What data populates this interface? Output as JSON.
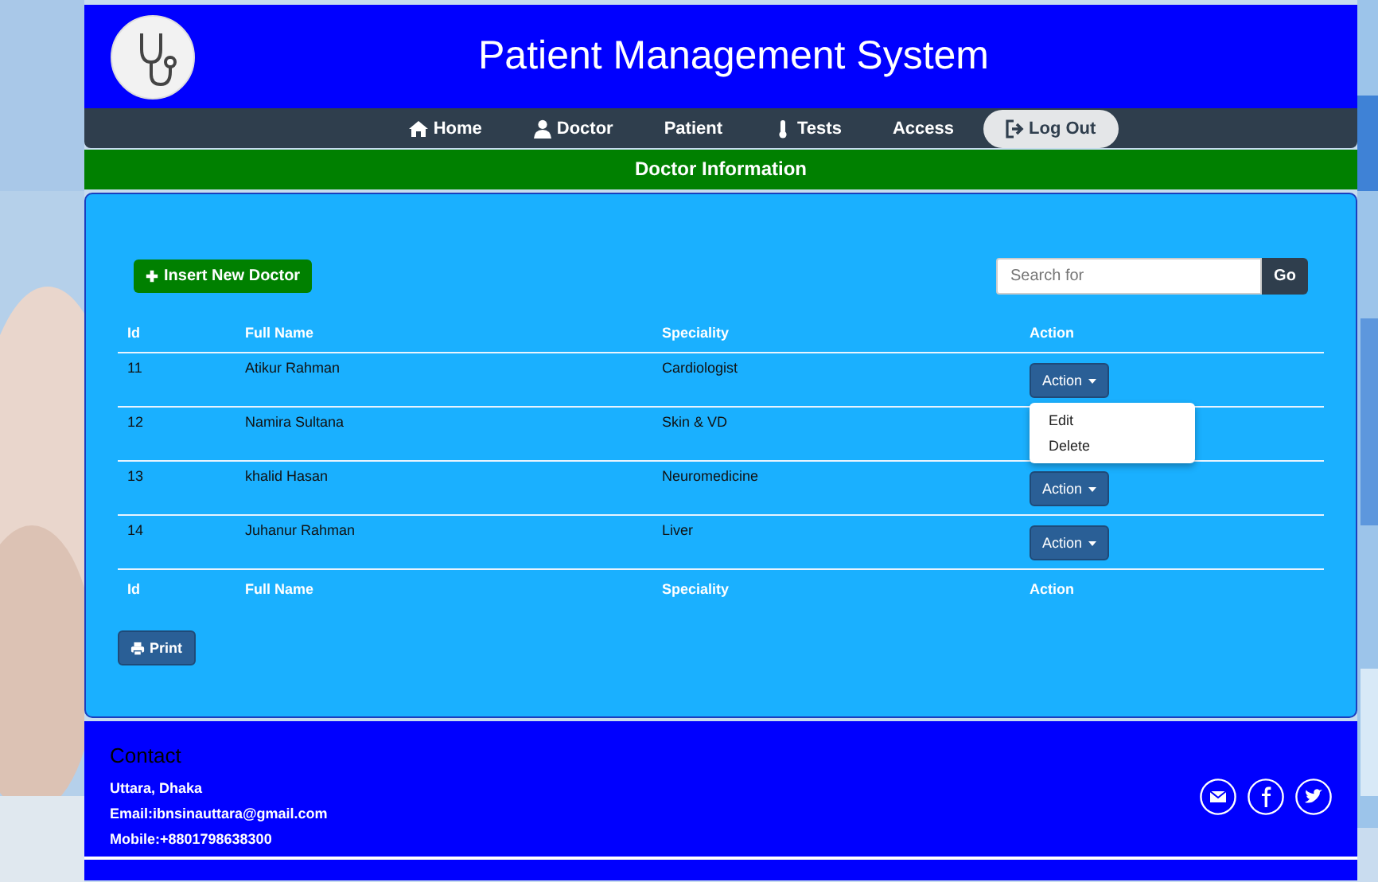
{
  "header": {
    "title": "Patient Management System"
  },
  "nav": [
    {
      "label": "Home",
      "selected": false
    },
    {
      "label": "Doctor",
      "selected": false
    },
    {
      "label": "Patient",
      "selected": false
    },
    {
      "label": "Tests",
      "selected": false
    },
    {
      "label": "Access",
      "selected": false
    },
    {
      "label": "Log Out",
      "selected": true
    }
  ],
  "section_title": "Doctor Information",
  "insert_button": "Insert New Doctor",
  "search": {
    "placeholder": "Search for",
    "button": "Go"
  },
  "table": {
    "columns": [
      "Id",
      "Full Name",
      "Speciality",
      "Action"
    ],
    "rows": [
      {
        "id": "11",
        "name": "Atikur Rahman",
        "speciality": "Cardiologist",
        "action": "Action",
        "menu": [
          "Edit",
          "Delete"
        ]
      },
      {
        "id": "12",
        "name": "Namira Sultana",
        "speciality": "Skin & VD"
      },
      {
        "id": "13",
        "name": "khalid Hasan",
        "speciality": "Neuromedicine",
        "action": "Action"
      },
      {
        "id": "14",
        "name": "Juhanur Rahman",
        "speciality": "Liver",
        "action": "Action"
      }
    ],
    "footer_columns": [
      "Id",
      "Full Name",
      "Speciality",
      "Action"
    ]
  },
  "print_button": "Print",
  "footer": {
    "heading": "Contact",
    "lines": [
      "Uttara, Dhaka",
      "Email:ibnsinauttara@gmail.com",
      "Mobile:+8801798638300"
    ]
  }
}
